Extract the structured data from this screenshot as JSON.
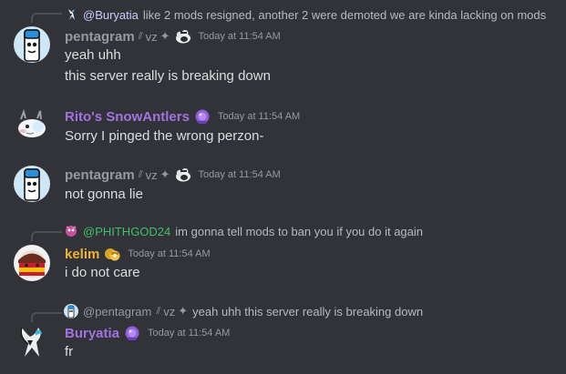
{
  "colors": {
    "background": "#313338",
    "name_pentagram": "#949ba4",
    "name_rito": "#a173e0",
    "name_kelim": "#f0b232",
    "name_buryatia": "#a173e0",
    "mention_green": "#3fbf6a",
    "mention_blue": "#c9cdfb"
  },
  "messages": [
    {
      "reply": {
        "name": "@Buryatia",
        "text": "like 2 mods resigned, another 2 were demoted we are kinda lacking on mods"
      },
      "author": "pentagram",
      "tag": "vz",
      "time": "Today at 11:54 AM",
      "lines": [
        "yeah uhh",
        "this server really is breaking down"
      ]
    },
    {
      "author": "Rito's SnowAntlers",
      "time": "Today at 11:54 AM",
      "lines": [
        "Sorry I pinged the wrong perzon-"
      ]
    },
    {
      "author": "pentagram",
      "tag": "vz",
      "time": "Today at 11:54 AM",
      "lines": [
        "not gonna lie"
      ]
    },
    {
      "reply": {
        "name": "@PHITHGOD24",
        "text": "im gonna tell mods to ban you if you do it again"
      },
      "author": "kelim",
      "time": "Today at 11:54 AM",
      "lines": [
        "i do not care"
      ]
    },
    {
      "reply": {
        "name": "@pentagram",
        "tag": "vz",
        "text": "yeah uhh this server really is breaking down"
      },
      "author": "Buryatia",
      "time": "Today at 11:54 AM",
      "lines": [
        "fr"
      ]
    }
  ]
}
